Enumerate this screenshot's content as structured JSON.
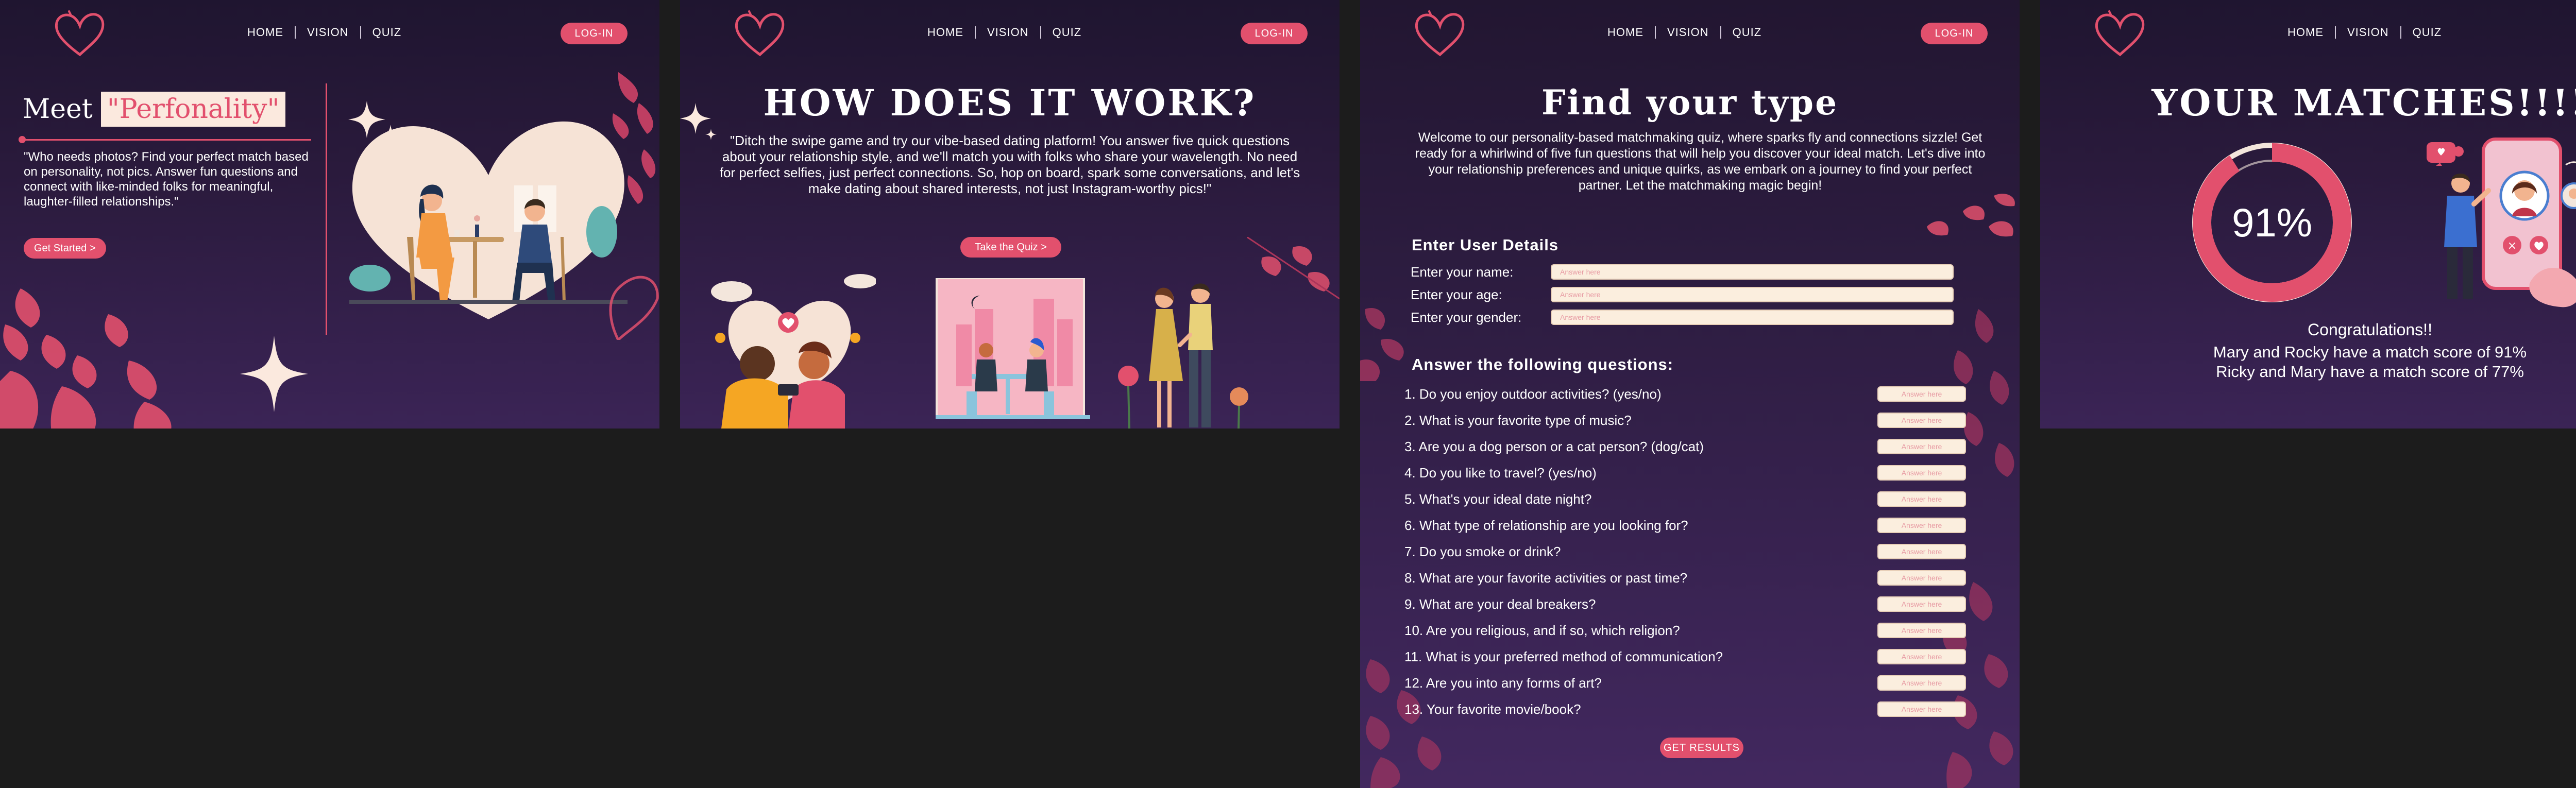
{
  "nav": {
    "home": "HOME",
    "vision": "VISION",
    "quiz": "QUIZ",
    "login": "LOG-IN"
  },
  "colors": {
    "accent": "#e2506d",
    "cream": "#fbe9de",
    "bg_dark": "#1f1530",
    "bg_light": "#3b2456"
  },
  "home": {
    "title_prefix": "Meet",
    "title_highlight": "\"Perfonality\"",
    "description": "\"Who needs photos? Find your perfect match based on personality, not pics. Answer fun questions and connect with like-minded folks for meaningful, laughter-filled relationships.\"",
    "cta": "Get Started >"
  },
  "how": {
    "title": "HOW DOES IT WORK?",
    "description": "\"Ditch the swipe game and try our vibe-based dating platform! You answer five quick questions about your relationship style, and we'll match you with folks who share your wavelength. No need for perfect selfies, just perfect connections. So, hop on board, spark some conversations, and let's make dating about shared interests, not just Instagram-worthy pics!\"",
    "cta": "Take the Quiz >"
  },
  "quiz": {
    "title": "Find your type",
    "description": "Welcome to our personality-based matchmaking quiz, where sparks fly and connections sizzle! Get ready for a whirlwind of five fun questions that will help you discover your ideal match. Let's dive into your relationship preferences and unique quirks, as we embark on a journey to find your perfect partner. Let the matchmaking magic begin!",
    "details_heading": "Enter User Details",
    "fields": [
      {
        "label": "Enter your name:",
        "placeholder": "Answer here"
      },
      {
        "label": "Enter your age:",
        "placeholder": "Answer here"
      },
      {
        "label": "Enter your gender:",
        "placeholder": "Answer here"
      }
    ],
    "questions_heading": "Answer the following questions:",
    "answer_placeholder": "Answer here",
    "questions": [
      "1. Do you enjoy outdoor activities? (yes/no)",
      "2. What is your favorite type of music?",
      "3. Are you a dog person or a cat person? (dog/cat)",
      "4. Do you like to travel? (yes/no)",
      "5. What's your ideal date night?",
      "6. What type of relationship are you looking for?",
      "7. Do you smoke or drink?",
      "8. What are your favorite activities or past time?",
      "9. What are your deal breakers?",
      "10. Are you religious, and if so, which religion?",
      "11. What is your preferred method of communication?",
      "12. Are you into any forms of art?",
      "13. Your favorite movie/book?"
    ],
    "submit": "GET RESULTS"
  },
  "matches": {
    "title": "YOUR MATCHES!!!!",
    "score_label": "91%",
    "score_value": 0.91,
    "congrats": "Congratulations!!",
    "results": [
      "Mary and Rocky have a match score of 91%",
      "Ricky and Mary have a match score of 77%"
    ]
  }
}
